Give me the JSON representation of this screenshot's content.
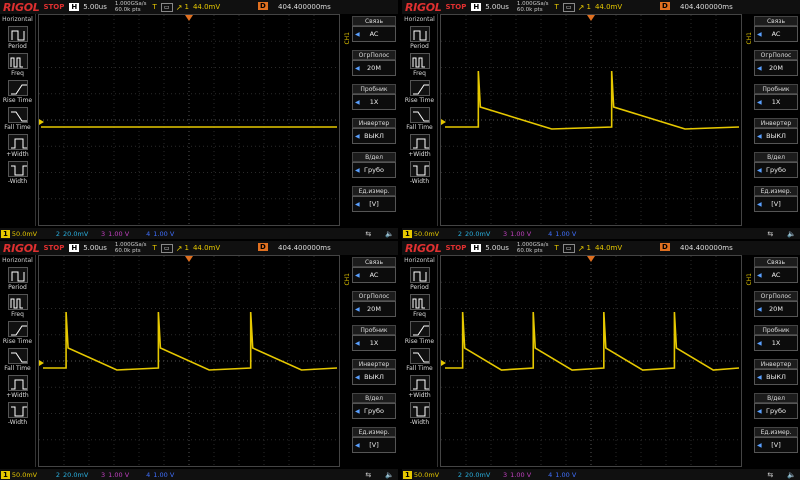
{
  "colors": {
    "ch1": "#e6c800",
    "ch2": "#2ab0e0",
    "ch3": "#c040c0",
    "ch4": "#4070ff",
    "brand": "#e03030",
    "delay": "#e07020"
  },
  "panels": [
    {
      "header": {
        "logo": "RIGOL",
        "status": "STOP",
        "h_badge": "H",
        "timebase": "5.00us",
        "sample_rate": "1.000GSa/s",
        "points": "60.0k pts",
        "trig_t": "T",
        "trig_src": "1",
        "trig_level": "44.0mV",
        "delay_badge": "D",
        "delay_value": "404.400000ms"
      },
      "left_menu": {
        "title": "Horizontal",
        "items": [
          "Period",
          "Freq",
          "Rise Time",
          "Fall Time",
          "+Width",
          "-Width"
        ]
      },
      "right_menu": {
        "channel": "CH1",
        "items": [
          {
            "label": "Связь",
            "value": "AC"
          },
          {
            "label": "ОгрПолос",
            "value": "20M"
          },
          {
            "label": "Пробник",
            "value": "1X"
          },
          {
            "label": "Инвертер",
            "value": "ВЫКЛ"
          },
          {
            "label": "В/дел",
            "value": "Грубо"
          },
          {
            "label": "Ед.измер.",
            "value": "[V]"
          }
        ]
      },
      "footer": {
        "ch1": "1",
        "ch1_scale": "50.0mV",
        "ch2": "2",
        "ch2_scale": "20.0mV",
        "ch3": "3",
        "ch3_scale": "1.00 V",
        "ch4": "4",
        "ch4_scale": "1.00 V",
        "usb": "⇆",
        "speaker": "🔈"
      },
      "waveform": {
        "type": "flat",
        "periods": 0
      }
    },
    {
      "header": {
        "logo": "RIGOL",
        "status": "STOP",
        "h_badge": "H",
        "timebase": "5.00us",
        "sample_rate": "1.000GSa/s",
        "points": "60.0k pts",
        "trig_t": "T",
        "trig_src": "1",
        "trig_level": "44.0mV",
        "delay_badge": "D",
        "delay_value": "404.400000ms"
      },
      "left_menu": {
        "title": "Horizontal",
        "items": [
          "Period",
          "Freq",
          "Rise Time",
          "Fall Time",
          "+Width",
          "-Width"
        ]
      },
      "right_menu": {
        "channel": "CH1",
        "items": [
          {
            "label": "Связь",
            "value": "AC"
          },
          {
            "label": "ОгрПолос",
            "value": "20M"
          },
          {
            "label": "Пробник",
            "value": "1X"
          },
          {
            "label": "Инвертер",
            "value": "ВЫКЛ"
          },
          {
            "label": "В/дел",
            "value": "Грубо"
          },
          {
            "label": "Ед.измер.",
            "value": "[V]"
          }
        ]
      },
      "footer": {
        "ch1": "1",
        "ch1_scale": "50.0mV",
        "ch2": "2",
        "ch2_scale": "20.0mV",
        "ch3": "3",
        "ch3_scale": "1.00 V",
        "ch4": "4",
        "ch4_scale": "1.00 V",
        "usb": "⇆",
        "speaker": "🔈"
      },
      "waveform": {
        "type": "sawtooth",
        "periods": 2
      }
    },
    {
      "header": {
        "logo": "RIGOL",
        "status": "STOP",
        "h_badge": "H",
        "timebase": "5.00us",
        "sample_rate": "1.000GSa/s",
        "points": "60.0k pts",
        "trig_t": "T",
        "trig_src": "1",
        "trig_level": "44.0mV",
        "delay_badge": "D",
        "delay_value": "404.400000ms"
      },
      "left_menu": {
        "title": "Horizontal",
        "items": [
          "Period",
          "Freq",
          "Rise Time",
          "Fall Time",
          "+Width",
          "-Width"
        ]
      },
      "right_menu": {
        "channel": "CH1",
        "items": [
          {
            "label": "Связь",
            "value": "AC"
          },
          {
            "label": "ОгрПолос",
            "value": "20M"
          },
          {
            "label": "Пробник",
            "value": "1X"
          },
          {
            "label": "Инвертер",
            "value": "ВЫКЛ"
          },
          {
            "label": "В/дел",
            "value": "Грубо"
          },
          {
            "label": "Ед.измер.",
            "value": "[V]"
          }
        ]
      },
      "footer": {
        "ch1": "1",
        "ch1_scale": "50.0mV",
        "ch2": "2",
        "ch2_scale": "20.0mV",
        "ch3": "3",
        "ch3_scale": "1.00 V",
        "ch4": "4",
        "ch4_scale": "1.00 V",
        "usb": "⇆",
        "speaker": "🔈"
      },
      "waveform": {
        "type": "sawtooth",
        "periods": 3
      }
    },
    {
      "header": {
        "logo": "RIGOL",
        "status": "STOP",
        "h_badge": "H",
        "timebase": "5.00us",
        "sample_rate": "1.000GSa/s",
        "points": "60.0k pts",
        "trig_t": "T",
        "trig_src": "1",
        "trig_level": "44.0mV",
        "delay_badge": "D",
        "delay_value": "404.400000ms"
      },
      "left_menu": {
        "title": "Horizontal",
        "items": [
          "Period",
          "Freq",
          "Rise Time",
          "Fall Time",
          "+Width",
          "-Width"
        ]
      },
      "right_menu": {
        "channel": "CH1",
        "items": [
          {
            "label": "Связь",
            "value": "AC"
          },
          {
            "label": "ОгрПолос",
            "value": "20M"
          },
          {
            "label": "Пробник",
            "value": "1X"
          },
          {
            "label": "Инвертер",
            "value": "ВЫКЛ"
          },
          {
            "label": "В/дел",
            "value": "Грубо"
          },
          {
            "label": "Ед.измер.",
            "value": "[V]"
          }
        ]
      },
      "footer": {
        "ch1": "1",
        "ch1_scale": "50.0mV",
        "ch2": "2",
        "ch2_scale": "20.0mV",
        "ch3": "3",
        "ch3_scale": "1.00 V",
        "ch4": "4",
        "ch4_scale": "1.00 V",
        "usb": "⇆",
        "speaker": "🔈"
      },
      "waveform": {
        "type": "sawtooth",
        "periods": 4
      }
    }
  ]
}
